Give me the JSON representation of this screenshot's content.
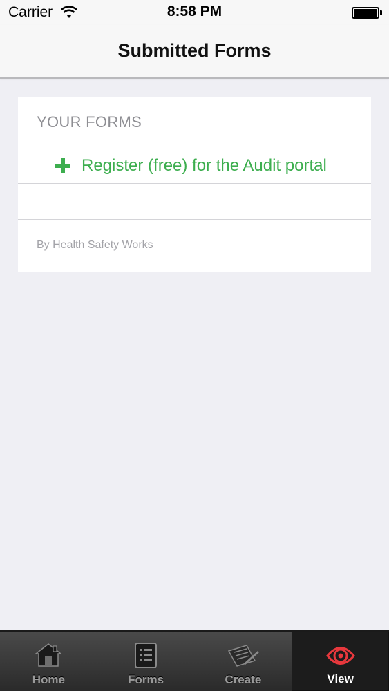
{
  "status_bar": {
    "carrier": "Carrier",
    "time": "8:58 PM"
  },
  "nav": {
    "title": "Submitted Forms"
  },
  "forms_section": {
    "header": "YOUR FORMS",
    "register_label": "Register (free) for the Audit portal",
    "footer": "By Health Safety Works"
  },
  "tab_bar": {
    "selected": "View",
    "tabs": [
      {
        "label": "Home",
        "icon": "home-icon"
      },
      {
        "label": "Forms",
        "icon": "list-icon"
      },
      {
        "label": "Create",
        "icon": "create-document-icon"
      },
      {
        "label": "View",
        "icon": "eye-target-icon"
      }
    ]
  },
  "colors": {
    "accent_green": "#3dae4f",
    "view_icon_red": "#e8383d",
    "background": "#efeff4"
  }
}
